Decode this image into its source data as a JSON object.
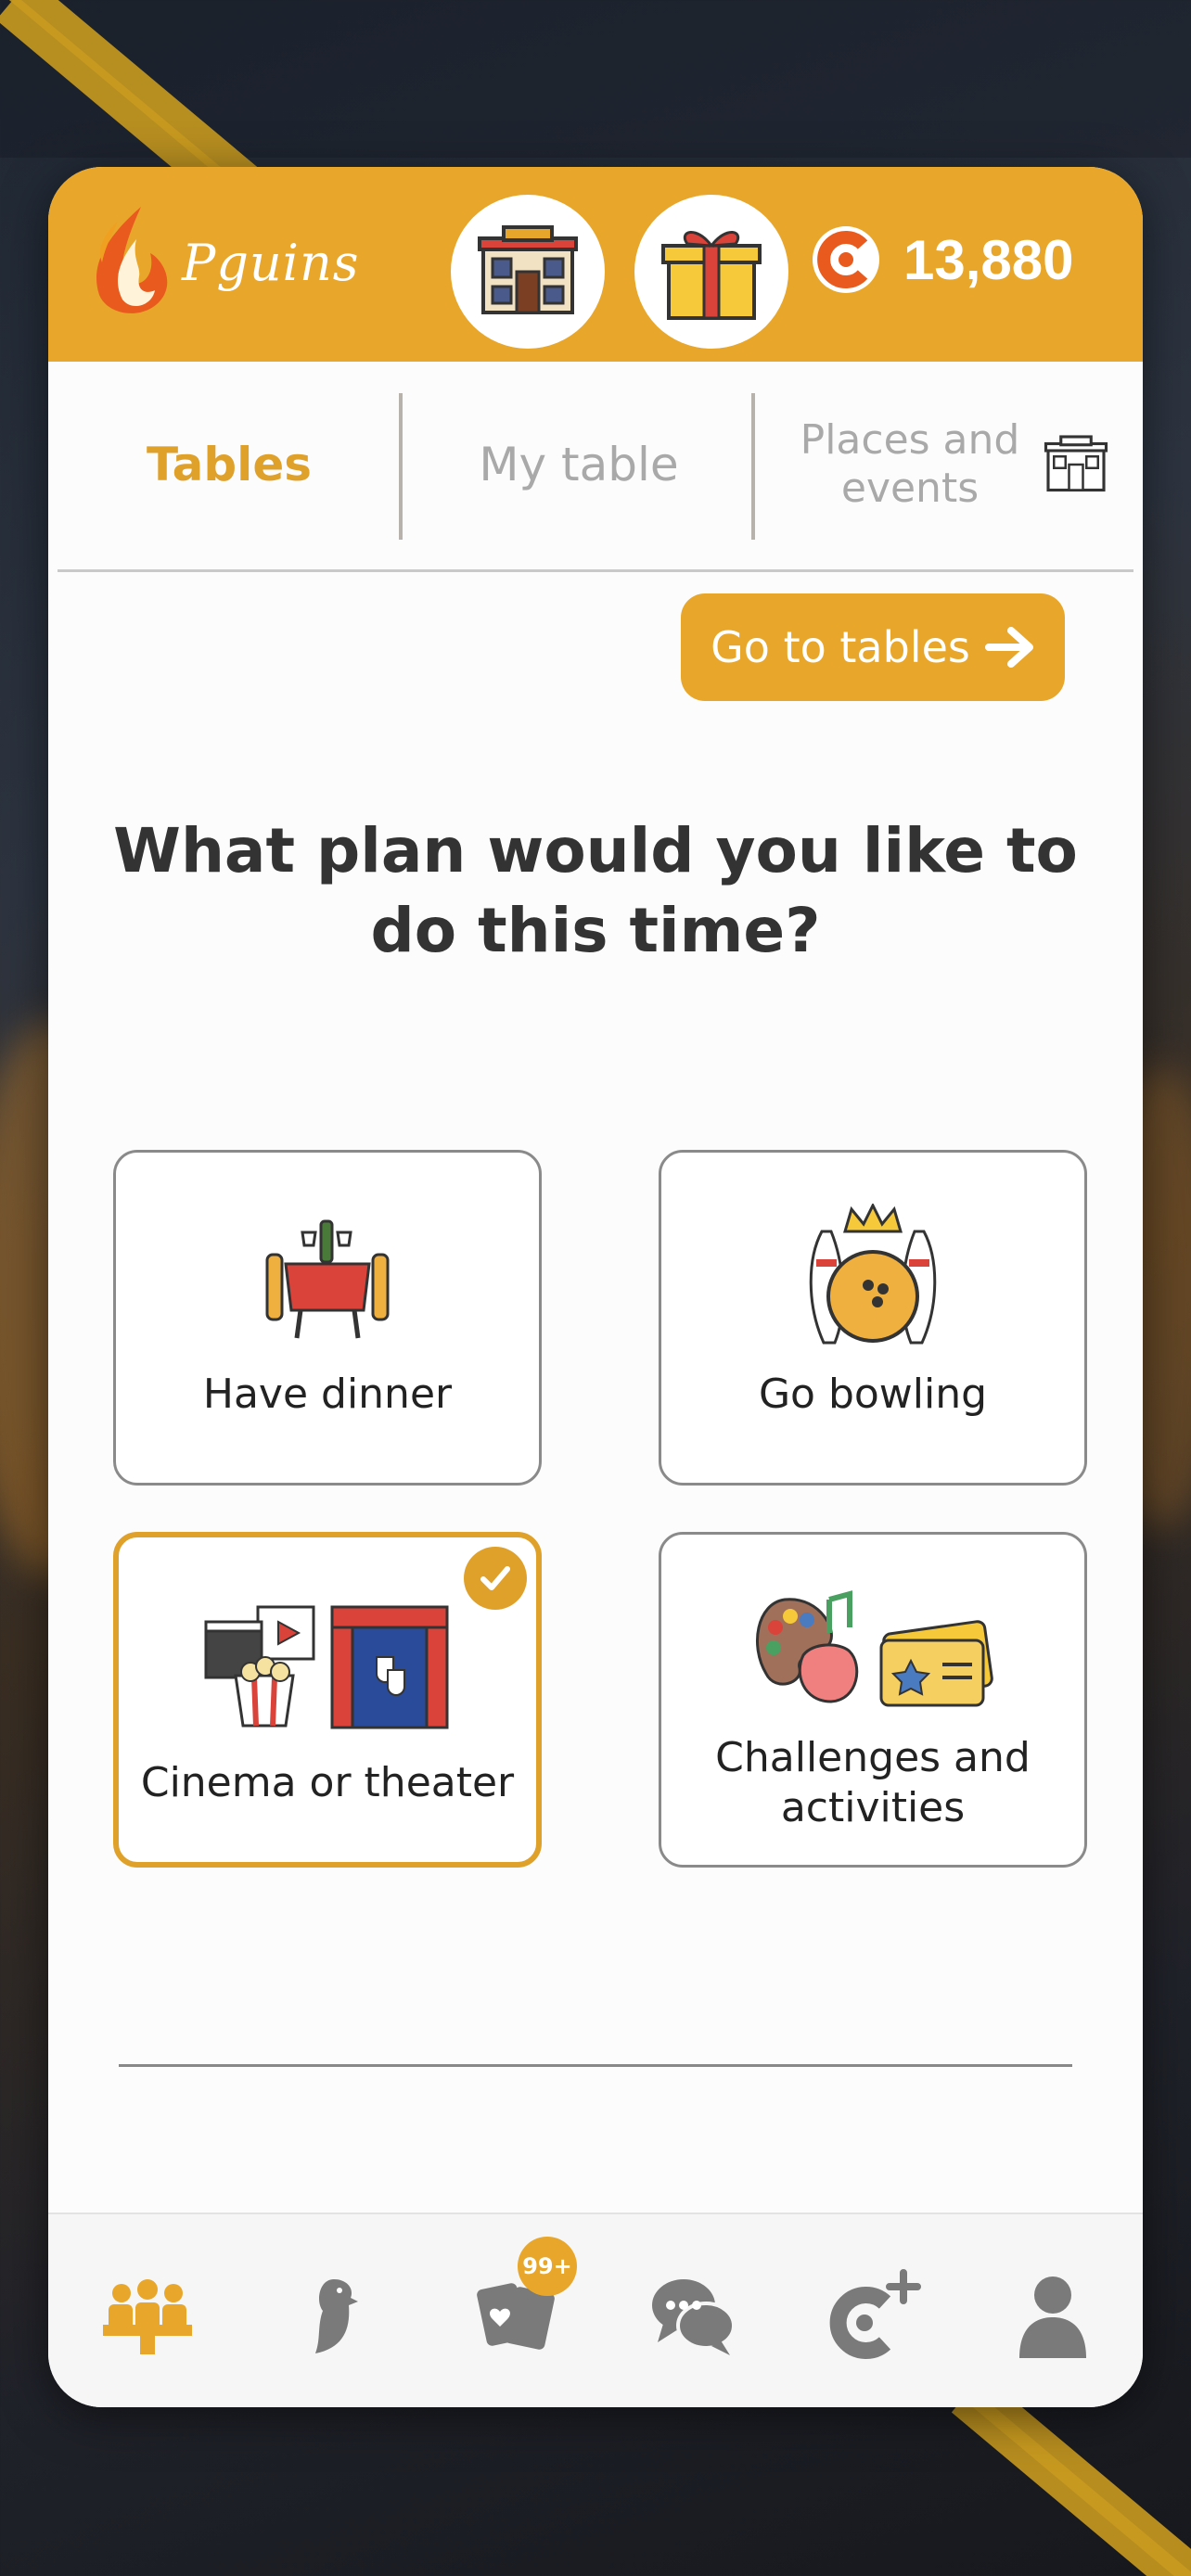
{
  "app": {
    "name": "Pguins",
    "coins": "13,880"
  },
  "header": {
    "venue_icon": "building-icon",
    "gift_icon": "gift-icon",
    "coin_icon": "coin-icon"
  },
  "tabs": [
    {
      "label": "Tables",
      "active": true
    },
    {
      "label": "My table",
      "active": false
    },
    {
      "label": "Places and events",
      "active": false
    }
  ],
  "go_button": {
    "label": "Go to tables"
  },
  "question": "What plan would you like to do this time?",
  "options": [
    {
      "label": "Have dinner",
      "icon": "dinner-table-icon",
      "selected": false
    },
    {
      "label": "Go bowling",
      "icon": "bowling-icon",
      "selected": false
    },
    {
      "label": "Cinema or theater",
      "icon": "cinema-theater-icon",
      "selected": true
    },
    {
      "label": "Challenges and activities",
      "icon": "activities-icon",
      "selected": false
    }
  ],
  "bottom_nav": [
    {
      "name": "tables-nav",
      "icon": "group-table-icon",
      "active": true
    },
    {
      "name": "penguin-nav",
      "icon": "penguin-icon",
      "active": false
    },
    {
      "name": "cards-nav",
      "icon": "cards-icon",
      "badge": "99+",
      "active": false
    },
    {
      "name": "chat-nav",
      "icon": "chat-icon",
      "active": false
    },
    {
      "name": "coins-nav",
      "icon": "coin-plus-icon",
      "active": false
    },
    {
      "name": "profile-nav",
      "icon": "profile-icon",
      "active": false
    }
  ],
  "colors": {
    "accent": "#e8a72a",
    "text_dark": "#333333",
    "inactive": "#a9a9a9"
  }
}
